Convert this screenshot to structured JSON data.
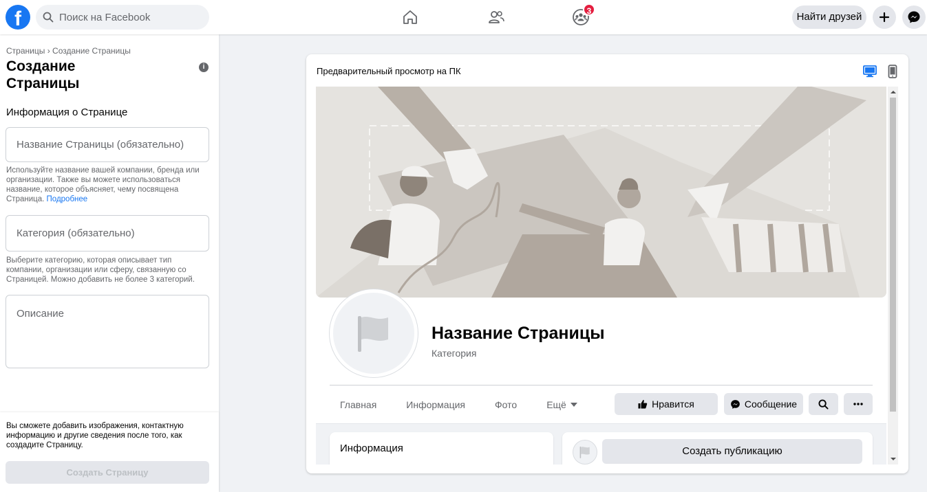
{
  "topbar": {
    "logo": "f",
    "search_placeholder": "Поиск на Facebook",
    "nav_icons": [
      "home-icon",
      "friends-icon",
      "groups-icon"
    ],
    "groups_badge": "3",
    "find_friends": "Найти друзей",
    "create_icon": "plus-icon",
    "messenger_icon": "messenger-icon"
  },
  "sidebar": {
    "breadcrumb_root": "Страницы",
    "breadcrumb_sep": "›",
    "breadcrumb_current": "Создание Страницы",
    "title": "Создание Страницы",
    "section_title": "Информация о Странице",
    "name_placeholder": "Название Страницы (обязательно)",
    "name_help": "Используйте название вашей компании, бренда или организации. Также вы можете использоваться название, которое объясняет, чему посвящена Страница.",
    "name_help_link": "Подробнее",
    "category_placeholder": "Категория (обязательно)",
    "category_help": "Выберите категорию, которая описывает тип компании, организации или сферу, связанную со Страницей. Можно добавить не более 3 категорий.",
    "description_placeholder": "Описание",
    "footer_note": "Вы сможете добавить изображения, контактную информацию и другие сведения после того, как создадите Страницу.",
    "create_button": "Создать Страницу"
  },
  "preview": {
    "title": "Предварительный просмотр на ПК",
    "desktop_icon": "desktop-icon",
    "mobile_icon": "mobile-icon",
    "page_name": "Название Страницы",
    "page_category": "Категория",
    "tabs": [
      "Главная",
      "Информация",
      "Фото",
      "Ещё"
    ],
    "like_button": "Нравится",
    "message_button": "Сообщение",
    "info_card_title": "Информация",
    "create_post": "Создать публикацию",
    "colors": {
      "accent": "#1877f2",
      "badge": "#e41e3f",
      "cover": "#e5e3df"
    }
  }
}
